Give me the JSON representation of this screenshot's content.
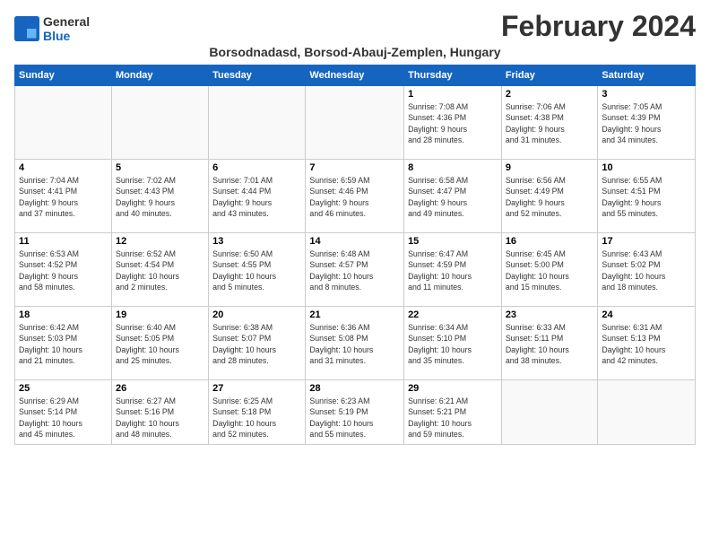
{
  "logo": {
    "line1": "General",
    "line2": "Blue"
  },
  "title": "February 2024",
  "subtitle": "Borsodnadasd, Borsod-Abauj-Zemplen, Hungary",
  "weekdays": [
    "Sunday",
    "Monday",
    "Tuesday",
    "Wednesday",
    "Thursday",
    "Friday",
    "Saturday"
  ],
  "weeks": [
    [
      {
        "day": "",
        "detail": ""
      },
      {
        "day": "",
        "detail": ""
      },
      {
        "day": "",
        "detail": ""
      },
      {
        "day": "",
        "detail": ""
      },
      {
        "day": "1",
        "detail": "Sunrise: 7:08 AM\nSunset: 4:36 PM\nDaylight: 9 hours\nand 28 minutes."
      },
      {
        "day": "2",
        "detail": "Sunrise: 7:06 AM\nSunset: 4:38 PM\nDaylight: 9 hours\nand 31 minutes."
      },
      {
        "day": "3",
        "detail": "Sunrise: 7:05 AM\nSunset: 4:39 PM\nDaylight: 9 hours\nand 34 minutes."
      }
    ],
    [
      {
        "day": "4",
        "detail": "Sunrise: 7:04 AM\nSunset: 4:41 PM\nDaylight: 9 hours\nand 37 minutes."
      },
      {
        "day": "5",
        "detail": "Sunrise: 7:02 AM\nSunset: 4:43 PM\nDaylight: 9 hours\nand 40 minutes."
      },
      {
        "day": "6",
        "detail": "Sunrise: 7:01 AM\nSunset: 4:44 PM\nDaylight: 9 hours\nand 43 minutes."
      },
      {
        "day": "7",
        "detail": "Sunrise: 6:59 AM\nSunset: 4:46 PM\nDaylight: 9 hours\nand 46 minutes."
      },
      {
        "day": "8",
        "detail": "Sunrise: 6:58 AM\nSunset: 4:47 PM\nDaylight: 9 hours\nand 49 minutes."
      },
      {
        "day": "9",
        "detail": "Sunrise: 6:56 AM\nSunset: 4:49 PM\nDaylight: 9 hours\nand 52 minutes."
      },
      {
        "day": "10",
        "detail": "Sunrise: 6:55 AM\nSunset: 4:51 PM\nDaylight: 9 hours\nand 55 minutes."
      }
    ],
    [
      {
        "day": "11",
        "detail": "Sunrise: 6:53 AM\nSunset: 4:52 PM\nDaylight: 9 hours\nand 58 minutes."
      },
      {
        "day": "12",
        "detail": "Sunrise: 6:52 AM\nSunset: 4:54 PM\nDaylight: 10 hours\nand 2 minutes."
      },
      {
        "day": "13",
        "detail": "Sunrise: 6:50 AM\nSunset: 4:55 PM\nDaylight: 10 hours\nand 5 minutes."
      },
      {
        "day": "14",
        "detail": "Sunrise: 6:48 AM\nSunset: 4:57 PM\nDaylight: 10 hours\nand 8 minutes."
      },
      {
        "day": "15",
        "detail": "Sunrise: 6:47 AM\nSunset: 4:59 PM\nDaylight: 10 hours\nand 11 minutes."
      },
      {
        "day": "16",
        "detail": "Sunrise: 6:45 AM\nSunset: 5:00 PM\nDaylight: 10 hours\nand 15 minutes."
      },
      {
        "day": "17",
        "detail": "Sunrise: 6:43 AM\nSunset: 5:02 PM\nDaylight: 10 hours\nand 18 minutes."
      }
    ],
    [
      {
        "day": "18",
        "detail": "Sunrise: 6:42 AM\nSunset: 5:03 PM\nDaylight: 10 hours\nand 21 minutes."
      },
      {
        "day": "19",
        "detail": "Sunrise: 6:40 AM\nSunset: 5:05 PM\nDaylight: 10 hours\nand 25 minutes."
      },
      {
        "day": "20",
        "detail": "Sunrise: 6:38 AM\nSunset: 5:07 PM\nDaylight: 10 hours\nand 28 minutes."
      },
      {
        "day": "21",
        "detail": "Sunrise: 6:36 AM\nSunset: 5:08 PM\nDaylight: 10 hours\nand 31 minutes."
      },
      {
        "day": "22",
        "detail": "Sunrise: 6:34 AM\nSunset: 5:10 PM\nDaylight: 10 hours\nand 35 minutes."
      },
      {
        "day": "23",
        "detail": "Sunrise: 6:33 AM\nSunset: 5:11 PM\nDaylight: 10 hours\nand 38 minutes."
      },
      {
        "day": "24",
        "detail": "Sunrise: 6:31 AM\nSunset: 5:13 PM\nDaylight: 10 hours\nand 42 minutes."
      }
    ],
    [
      {
        "day": "25",
        "detail": "Sunrise: 6:29 AM\nSunset: 5:14 PM\nDaylight: 10 hours\nand 45 minutes."
      },
      {
        "day": "26",
        "detail": "Sunrise: 6:27 AM\nSunset: 5:16 PM\nDaylight: 10 hours\nand 48 minutes."
      },
      {
        "day": "27",
        "detail": "Sunrise: 6:25 AM\nSunset: 5:18 PM\nDaylight: 10 hours\nand 52 minutes."
      },
      {
        "day": "28",
        "detail": "Sunrise: 6:23 AM\nSunset: 5:19 PM\nDaylight: 10 hours\nand 55 minutes."
      },
      {
        "day": "29",
        "detail": "Sunrise: 6:21 AM\nSunset: 5:21 PM\nDaylight: 10 hours\nand 59 minutes."
      },
      {
        "day": "",
        "detail": ""
      },
      {
        "day": "",
        "detail": ""
      }
    ]
  ]
}
